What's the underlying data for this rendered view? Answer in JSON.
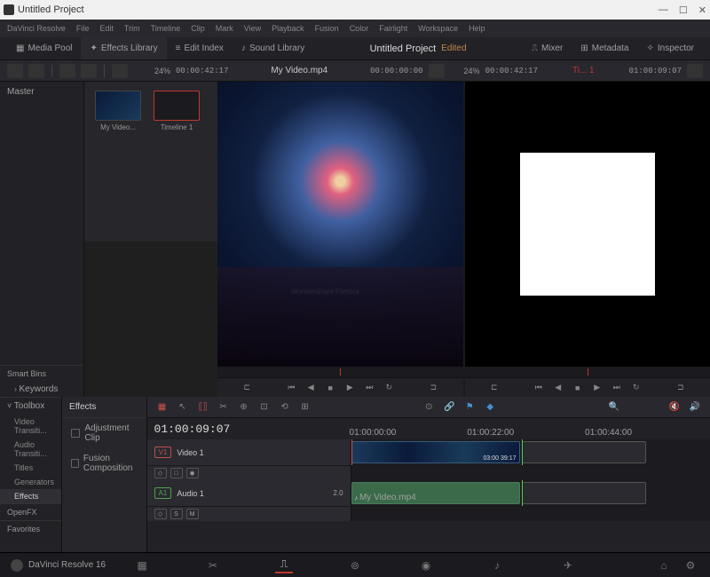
{
  "window": {
    "title": "Untitled Project"
  },
  "menu": [
    "DaVinci Resolve",
    "File",
    "Edit",
    "Trim",
    "Timeline",
    "Clip",
    "Mark",
    "View",
    "Playback",
    "Fusion",
    "Color",
    "Fairlight",
    "Workspace",
    "Help"
  ],
  "workspace": {
    "items": [
      "Media Pool",
      "Effects Library",
      "Edit Index",
      "Sound Library"
    ],
    "title": "Untitled Project",
    "status": "Edited",
    "right": [
      "Mixer",
      "Metadata",
      "Inspector"
    ]
  },
  "viewer_bar": {
    "left": {
      "zoom": "24%",
      "tc": "00:00:42:17",
      "name": "My Video.mp4",
      "tc2": "00:00:00:00"
    },
    "right": {
      "zoom": "24%",
      "tc": "00:00:42:17",
      "name": "Ti... 1",
      "tc2": "01:00:09:07"
    }
  },
  "sidebar": {
    "master": "Master",
    "smart": "Smart Bins",
    "keywords": "Keywords",
    "toolbox": {
      "label": "Toolbox",
      "items": [
        "Video Transiti...",
        "Audio Transiti...",
        "Titles",
        "Generators",
        "Effects"
      ]
    },
    "openfx": "OpenFX",
    "favorites": "Favorites"
  },
  "pool": {
    "items": [
      {
        "label": "My Video..."
      },
      {
        "label": "Timeline 1"
      }
    ]
  },
  "fx": {
    "header": "Effects",
    "items": [
      "Adjustment Clip",
      "Fusion Composition"
    ]
  },
  "watermark": "Wondershare Filmora",
  "timeline": {
    "tc": "01:00:09:07",
    "ruler": [
      "01:00:00:00",
      "01:00:22:00",
      "01:00:44:00"
    ],
    "tracks": {
      "v1": {
        "badge": "V1",
        "name": "Video 1",
        "btns": [
          "◇",
          "□",
          "◉"
        ],
        "clip_tc": "03:00 39:17"
      },
      "a1": {
        "badge": "A1",
        "name": "Audio 1",
        "num": "2.0",
        "btns": [
          "◇",
          "S",
          "M"
        ],
        "clip": "My Video.mp4"
      }
    }
  },
  "bottom": {
    "app": "DaVinci Resolve 16"
  }
}
